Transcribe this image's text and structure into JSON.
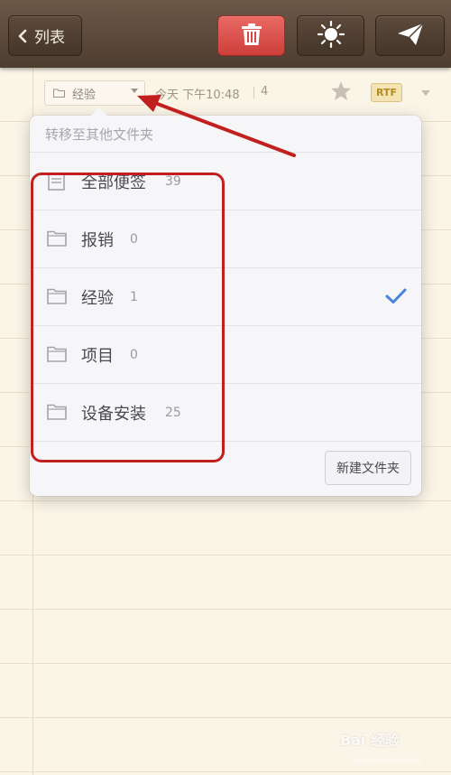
{
  "toolbar": {
    "back_label": "列表",
    "delete_color": "#d9504b"
  },
  "note_meta": {
    "folder": "经验",
    "date": "今天 下午10:48",
    "word_count": "4",
    "format_badge": "RTF"
  },
  "folder_menu": {
    "header": "转移至其他文件夹",
    "items": [
      {
        "label": "全部便签",
        "count": "39",
        "icon": "note-icon",
        "selected": false
      },
      {
        "label": "报销",
        "count": "0",
        "icon": "folder-icon",
        "selected": false
      },
      {
        "label": "经验",
        "count": "1",
        "icon": "folder-icon",
        "selected": true
      },
      {
        "label": "项目",
        "count": "0",
        "icon": "folder-icon",
        "selected": false
      },
      {
        "label": "设备安装",
        "count": "25",
        "icon": "folder-icon",
        "selected": false
      }
    ],
    "new_folder_label": "新建文件夹",
    "check_color": "#4a86d8"
  },
  "annotation": {
    "color": "#c21f1f"
  },
  "watermark": {
    "text": "Bai 经验",
    "url": "jingyan.baidu.com"
  }
}
